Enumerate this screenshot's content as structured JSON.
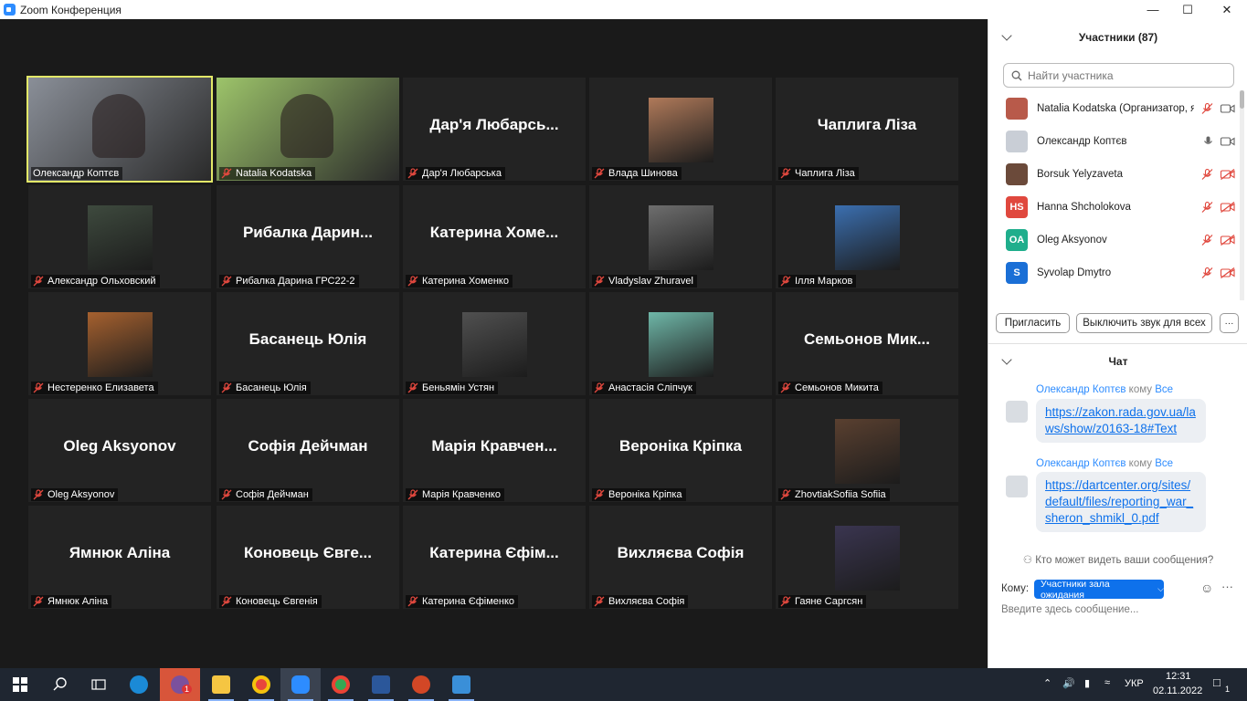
{
  "window": {
    "title": "Zoom Конференция",
    "minimize": "—",
    "maximize": "☐",
    "close": "✕"
  },
  "gallery": [
    {
      "label": "Олександр Коптєв",
      "camera": true,
      "active": true,
      "photo_color": "#8a8f98",
      "muted": false
    },
    {
      "label": "Natalia Kodatska",
      "camera": true,
      "photo_color": "#9dc46a",
      "muted": true
    },
    {
      "label": "Дар'я Любарська",
      "big": "Дар'я Любарсь...",
      "muted": true
    },
    {
      "label": "Влада Шинова",
      "avatar": true,
      "photo_color": "#b07a5a",
      "muted": true
    },
    {
      "label": "Чаплига Ліза",
      "big": "Чаплига Ліза",
      "muted": true
    },
    {
      "label": "Александр Ольховский",
      "avatar": true,
      "photo_color": "#3e4a3e",
      "muted": true
    },
    {
      "label": "Рибалка Дарина ГРС22-2",
      "big": "Рибалка Дарин...",
      "muted": true
    },
    {
      "label": "Катерина Хоменко",
      "big": "Катерина Хоме...",
      "muted": true
    },
    {
      "label": "Vladyslav Zhuravel",
      "avatar": true,
      "photo_color": "#6e6e6e",
      "muted": true
    },
    {
      "label": "Ілля Марков",
      "avatar": true,
      "photo_color": "#3b6fb0",
      "muted": true
    },
    {
      "label": "Нестеренко Елизавета",
      "avatar": true,
      "photo_color": "#a6612f",
      "muted": true
    },
    {
      "label": "Басанець Юлія",
      "big": "Басанець Юлія",
      "muted": true
    },
    {
      "label": "Беньямін Устян",
      "avatar": true,
      "photo_color": "#505050",
      "muted": true
    },
    {
      "label": "Анастасія Сліпчук",
      "avatar": true,
      "photo_color": "#6fb7a8",
      "muted": true
    },
    {
      "label": "Семьонов Микита",
      "big": "Семьонов Мик...",
      "muted": true
    },
    {
      "label": "Oleg Aksyonov",
      "big": "Oleg Aksyonov",
      "muted": true
    },
    {
      "label": "Софія Дейчман",
      "big": "Софія Дейчман",
      "muted": true
    },
    {
      "label": "Марія Кравченко",
      "big": "Марія Кравчен...",
      "muted": true
    },
    {
      "label": "Вероніка Кріпка",
      "big": "Вероніка Кріпка",
      "muted": true
    },
    {
      "label": "ZhovtiakSofiia Sofiia",
      "avatar": true,
      "photo_color": "#5a4030",
      "muted": true
    },
    {
      "label": "Ямнюк Аліна",
      "big": "Ямнюк Аліна",
      "muted": true
    },
    {
      "label": "Коновець Євгенія",
      "big": "Коновець Євге...",
      "muted": true
    },
    {
      "label": "Катерина Єфіменко",
      "big": "Катерина Єфім...",
      "muted": true
    },
    {
      "label": "Вихляєва Софія",
      "big": "Вихляєва Софія",
      "muted": true
    },
    {
      "label": "Гаяне Саргсян",
      "avatar": true,
      "photo_color": "#3a3550",
      "muted": true
    }
  ],
  "participants_panel": {
    "title": "Участники (87)",
    "search_placeholder": "Найти участника",
    "list": [
      {
        "name": "Natalia Kodatska (Организатор, я)",
        "initials": "",
        "color": "#b85a4a",
        "mic_off": true,
        "video_off": false
      },
      {
        "name": "Олександр Коптєв",
        "initials": "",
        "color": "#c9ced6",
        "mic_off": false,
        "video_off": false
      },
      {
        "name": "Borsuk Yelyzaveta",
        "initials": "",
        "color": "#6b4a3a",
        "mic_off": true,
        "video_off": true
      },
      {
        "name": "Hanna Shcholokova",
        "initials": "HS",
        "color": "#e0483e",
        "mic_off": true,
        "video_off": true
      },
      {
        "name": "Oleg Aksyonov",
        "initials": "OA",
        "color": "#1fae8c",
        "mic_off": true,
        "video_off": true
      },
      {
        "name": "Syvolap Dmytro",
        "initials": "S",
        "color": "#1a6fd6",
        "mic_off": true,
        "video_off": true
      }
    ],
    "invite_button": "Пригласить",
    "mute_all_button": "Выключить звук для всех",
    "more_button": "···"
  },
  "chat_panel": {
    "title": "Чат",
    "messages": [
      {
        "sender": "Олександр Коптєв",
        "to_word": "кому",
        "to": "Все",
        "lines": [
          "https://zakon.rada.gov.ua/la",
          "ws/show/z0163-18#Text"
        ]
      },
      {
        "sender": "Олександр Коптєв",
        "to_word": "кому",
        "to": "Все",
        "lines": [
          "https://dartcenter.org/sites/",
          "default/files/reporting_war_",
          "sheron_shmikl_0.pdf"
        ]
      }
    ],
    "who_can_see": "Кто может видеть ваши сообщения?",
    "to_label": "Кому:",
    "to_select": "Участники зала ожидания",
    "input_placeholder": "Введите здесь сообщение..."
  },
  "taskbar": {
    "lang": "УКР",
    "time": "12:31",
    "date": "02.11.2022",
    "notifications": "1",
    "badge": "1"
  }
}
